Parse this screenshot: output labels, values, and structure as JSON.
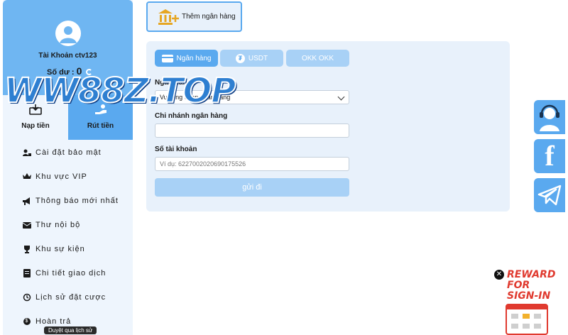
{
  "profile": {
    "account_label": "Tài Khoản ctv123",
    "balance_label": "Số dư :",
    "balance_value": "0"
  },
  "watermark": "WW88Z.TOP",
  "tabs": [
    {
      "label": "Nạp tiền",
      "icon": "deposit-icon"
    },
    {
      "label": "Rút tiền",
      "icon": "withdraw-icon"
    }
  ],
  "menu": [
    {
      "label": "Cài đặt bảo mật",
      "icon": "user-lock-icon"
    },
    {
      "label": "Khu vực VIP",
      "icon": "crown-icon"
    },
    {
      "label": "Thông báo mới nhất",
      "icon": "megaphone-icon"
    },
    {
      "label": "Thư nội bộ",
      "icon": "envelope-icon"
    },
    {
      "label": "Khu sự kiện",
      "icon": "trophy-icon"
    },
    {
      "label": "Chi tiết giao dịch",
      "icon": "receipt-icon"
    },
    {
      "label": "Lịch sử đặt cược",
      "icon": "history-icon"
    },
    {
      "label": "Hoàn trả",
      "icon": "coin-icon"
    }
  ],
  "tooltip": "Duyệt qua lịch sử",
  "add_bank": {
    "label": "Thêm ngân hàng"
  },
  "methods": [
    {
      "label": "Ngân hàng",
      "active": true
    },
    {
      "label": "USDT",
      "active": false
    },
    {
      "label": "OKK OKK",
      "active": false
    }
  ],
  "form": {
    "bank_label": "Ngân hàng",
    "bank_select_value": "Vui lòng chọn ngân hàng",
    "branch_label": "Chi nhánh ngân hàng",
    "branch_value": "",
    "account_label": "Số tài khoản",
    "account_placeholder": "Ví dụ:  6227002020690175526",
    "submit_label": "gửi đi"
  },
  "reward": {
    "line1": "REWARD",
    "line2": "FOR",
    "line3": "SIGN-IN"
  },
  "colors": {
    "accent": "#5aa9ef",
    "accent_light": "#a8d1f6",
    "panel": "#e8f1fb",
    "reward_red": "#e03a2f"
  }
}
